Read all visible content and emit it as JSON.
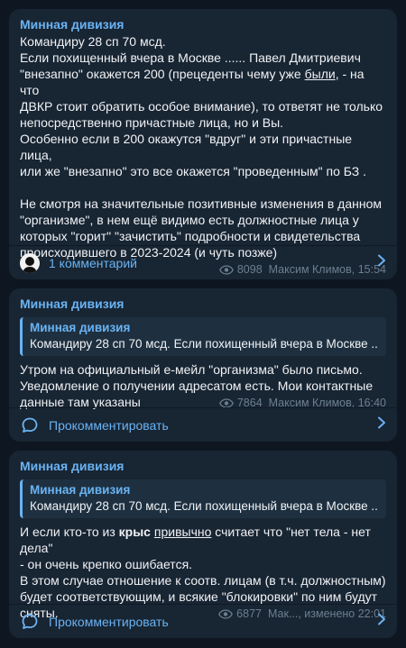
{
  "posts": [
    {
      "channel": "Минная дивизия",
      "lines": {
        "l1": "Командиру 28 сп 70 мсд.",
        "l2": "Если похищенный вчера в Москве ...... Павел Дмитриевич",
        "l3a": "\"внезапно\" окажется 200 (прецеденты чему уже ",
        "l3b": "были",
        "l3c": ", - на что",
        "l4": "ДВКР стоит обратить особое внимание), то ответят не только",
        "l5": "непосредственно причастные лица, но и Вы.",
        "l6": "Особенно если в 200 окажутся \"вдруг\" и эти причастные лица,",
        "l7": "или же \"внезапно\" это все окажется \"проведенным\" по БЗ .",
        "l8": "Не смотря на значительные позитивные изменения в данном",
        "l9": "\"организме\", в нем ещё видимо есть должностные лица у",
        "l10": "которых \"горит\" \"зачистить\" подробности и свидетельства",
        "l11": "происходившего в 2023-2024 (и чуть позже)"
      },
      "views": "8098",
      "author": "Максим Климов, 15:54",
      "comments_label": "1 комментарий"
    },
    {
      "channel": "Минная дивизия",
      "reply": {
        "title": "Минная дивизия",
        "text": "Командиру 28 сп 70 мсд. Если похищенный вчера в Москве ......"
      },
      "lines": {
        "l1": "Утром на официальный е-мейл \"организма\" было письмо.",
        "l2": "Уведомление о получении адресатом есть. Мои контактные",
        "l3": "данные там указаны"
      },
      "views": "7864",
      "author": "Максим Климов, 16:40",
      "comments_label": "Прокомментировать"
    },
    {
      "channel": "Минная дивизия",
      "reply": {
        "title": "Минная дивизия",
        "text": "Командиру 28 сп 70 мсд. Если похищенный вчера в Москве ......"
      },
      "lines": {
        "l1a": "И если кто-то из ",
        "l1b": "крыс",
        "l1c": " ",
        "l1d": "привычно",
        "l1e": "  считает что \"нет тела - нет дела\"",
        "l2": "- он очень крепко ошибается.",
        "l3": "В этом случае отношение к соотв. лицам (в т.ч. должностным)",
        "l4": "будет соответствующим, и всякие \"блокировки\" по ним будут",
        "l5": "сняты."
      },
      "views": "6877",
      "author": "Мак..., изменено 22:01",
      "comments_label": "Прокомментировать"
    }
  ],
  "colors": {
    "accent": "#6ab3f3",
    "card": "#182533",
    "background": "#0e1621"
  }
}
